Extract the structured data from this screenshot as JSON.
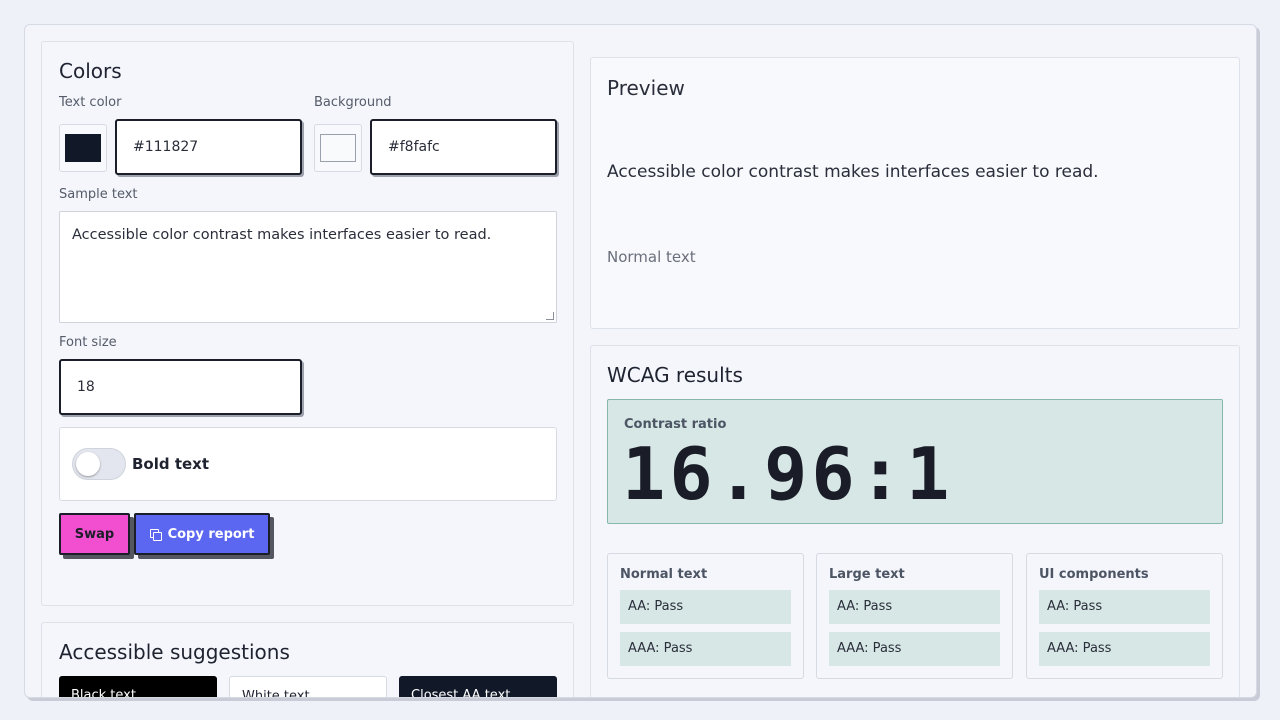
{
  "colors": {
    "title": "Colors",
    "text_color_label": "Text color",
    "text_color_value": "#111827",
    "background_label": "Background",
    "background_value": "#f8fafc",
    "sample_label": "Sample text",
    "sample_text": "Accessible color contrast makes interfaces easier to read.",
    "font_size_label": "Font size",
    "font_size_value": "18",
    "bold_label": "Bold text",
    "bold_on": false,
    "swap_label": "Swap",
    "copy_label": "Copy report"
  },
  "suggestions": {
    "title": "Accessible suggestions",
    "items": [
      {
        "label": "Black text"
      },
      {
        "label": "White text"
      },
      {
        "label": "Closest AA text"
      }
    ]
  },
  "preview": {
    "title": "Preview",
    "text": "Accessible color contrast makes interfaces easier to read.",
    "small_text": "Normal text"
  },
  "results": {
    "title": "WCAG results",
    "ratio_label": "Contrast ratio",
    "ratio_value": "16.96:1",
    "cards": [
      {
        "title": "Normal text",
        "aa": "AA: Pass",
        "aaa": "AAA: Pass"
      },
      {
        "title": "Large text",
        "aa": "AA: Pass",
        "aaa": "AAA: Pass"
      },
      {
        "title": "UI components",
        "aa": "AA: Pass",
        "aaa": "AAA: Pass"
      }
    ]
  },
  "theme": {
    "swap_color": "#f14fcf",
    "copy_color": "#5b67f0",
    "pass_color": "#d6e7e6",
    "text_chip": "#111827",
    "bg_chip": "#f8fafc"
  }
}
